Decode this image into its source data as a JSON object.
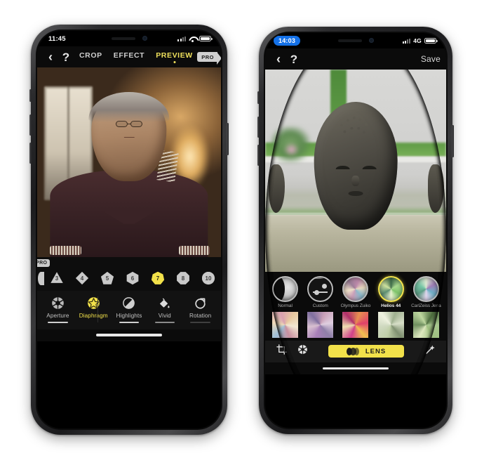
{
  "page": {
    "background": "#ffffff",
    "accent_yellow": "#f2e14a",
    "panel_dark": "#0b0b0b"
  },
  "phone1": {
    "status": {
      "time": "11:45",
      "signal_icon": "signal-bars-icon",
      "wifi_icon": "wifi-icon",
      "battery_icon": "battery-icon"
    },
    "nav": {
      "back_icon": "‹",
      "back_name": "back-chevron-icon",
      "help_icon": "?",
      "help_name": "help-question-icon",
      "tabs": [
        {
          "label": "CROP",
          "active": false
        },
        {
          "label": "EFFECT",
          "active": false
        },
        {
          "label": "PREVIEW",
          "active": true
        }
      ],
      "pro_badge": "PRO"
    },
    "photo": {
      "alt": "portrait of an older man wearing glasses and a dark polo shirt, blurred indoor background"
    },
    "aperture_rail": {
      "pro_badge": "PRO",
      "blades": [
        {
          "value": "",
          "sides": "cut",
          "selected": false
        },
        {
          "value": "3",
          "sides": "s3",
          "selected": false
        },
        {
          "value": "4",
          "sides": "s4",
          "selected": false
        },
        {
          "value": "5",
          "sides": "s5",
          "selected": false
        },
        {
          "value": "6",
          "sides": "s6",
          "selected": false
        },
        {
          "value": "7",
          "sides": "s7",
          "selected": true
        },
        {
          "value": "8",
          "sides": "s8",
          "selected": false
        },
        {
          "value": "10",
          "sides": "s10",
          "selected": false
        }
      ],
      "selected_value": "7"
    },
    "tools": [
      {
        "label": "Aperture",
        "icon": "aperture-icon",
        "selected": false
      },
      {
        "label": "Diaphragm",
        "icon": "diaphragm-star-icon",
        "selected": true
      },
      {
        "label": "Highlights",
        "icon": "highlights-icon",
        "selected": false
      },
      {
        "label": "Vivid",
        "icon": "paint-bucket-icon",
        "selected": false
      },
      {
        "label": "Rotation",
        "icon": "rotate-cw-icon",
        "selected": false
      }
    ]
  },
  "phone2": {
    "status": {
      "time": "14:03",
      "time_pill_color": "#1471e8",
      "signal_icon": "signal-bars-icon",
      "network": "4G",
      "battery_icon": "battery-icon"
    },
    "nav": {
      "back_icon": "‹",
      "back_name": "back-chevron-icon",
      "help_icon": "?",
      "help_name": "help-question-icon",
      "save_label": "Save"
    },
    "photo": {
      "alt": "stone buddha head sculpture on a table with blurred green and white background"
    },
    "lenses_row1": [
      {
        "label": "Normal",
        "selected": false,
        "style": "t-normal"
      },
      {
        "label": "Custom",
        "selected": false,
        "style": "t-custom"
      },
      {
        "label": "Olympus Zuiko",
        "selected": false,
        "style": "t-a"
      },
      {
        "label": "Helios 44",
        "selected": true,
        "style": "t-b"
      },
      {
        "label": "CarlZeiss Jena",
        "selected": false,
        "style": "t-c"
      }
    ],
    "lenses_row2": [
      {
        "label": "",
        "selected": false,
        "style": "t-d"
      },
      {
        "label": "",
        "selected": false,
        "style": "t-e"
      },
      {
        "label": "",
        "selected": false,
        "style": "t-f"
      },
      {
        "label": "",
        "selected": false,
        "style": "t-g"
      },
      {
        "label": "",
        "selected": false,
        "style": "t-h"
      }
    ],
    "bottombar": {
      "crop_icon": "crop-icon",
      "aperture_icon": "aperture-icon",
      "lens_label": "LENS",
      "lens_icon": "lens-stack-icon",
      "magic_icon": "magic-wand-icon"
    }
  }
}
